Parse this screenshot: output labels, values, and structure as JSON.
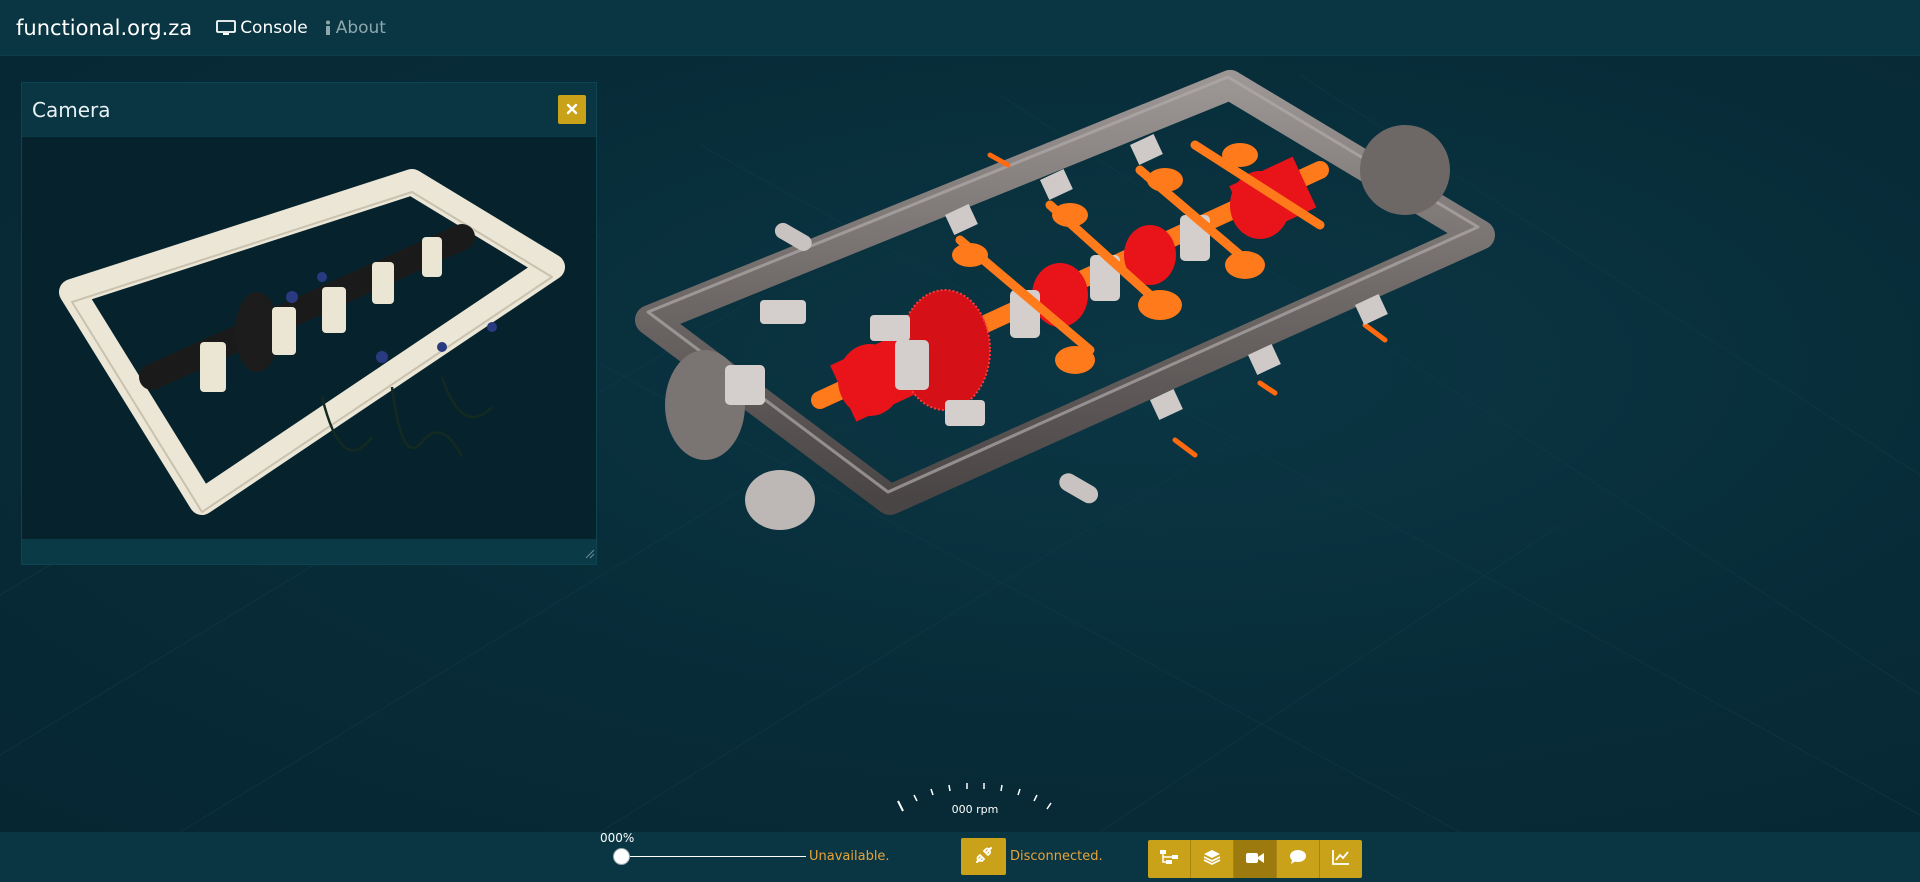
{
  "nav": {
    "brand": "functional.org.za",
    "links": [
      {
        "label": "Console",
        "icon": "monitor-icon",
        "active": true
      },
      {
        "label": "About",
        "icon": "info-icon",
        "active": false
      }
    ]
  },
  "camera_panel": {
    "title": "Camera",
    "close_icon": "close-icon"
  },
  "gauge": {
    "rpm_text": "000 rpm"
  },
  "controls": {
    "throttle_value": "000%",
    "throttle_level": 0,
    "throttle_status": "Unavailable.",
    "connection_status": "Disconnected.",
    "connect_icon": "plug-icon",
    "toolbar": [
      {
        "icon": "network-icon",
        "active": false
      },
      {
        "icon": "layers-icon",
        "active": false
      },
      {
        "icon": "video-camera-icon",
        "active": true
      },
      {
        "icon": "chat-icon",
        "active": false
      },
      {
        "icon": "chart-icon",
        "active": false
      }
    ]
  },
  "colors": {
    "background": "#072b37",
    "accent": "#c9a21a",
    "status": "#e8a33a"
  }
}
